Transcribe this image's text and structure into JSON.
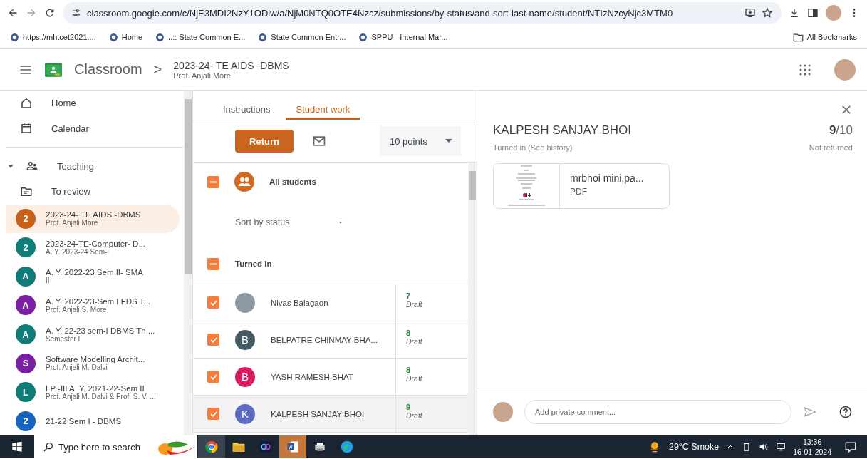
{
  "browser": {
    "url": "classroom.google.com/c/NjE3MDI2NzY1ODlw/a/NjM0NTQ0OTE4Nzcz/submissions/by-status/and-sort-last-name/student/NTIzNzcyNjc3MTM0",
    "bookmarks": [
      {
        "label": "https://mhtcet2021...."
      },
      {
        "label": "Home"
      },
      {
        "label": "..:: State Common E..."
      },
      {
        "label": "State Common Entr..."
      },
      {
        "label": "SPPU - Internal Mar..."
      }
    ],
    "all_bookmarks": "All Bookmarks"
  },
  "header": {
    "app": "Classroom",
    "separator": ">",
    "class_title": "2023-24- TE AIDS -DBMS",
    "teacher": "Prof. Anjali More"
  },
  "sidebar": {
    "nav": [
      {
        "label": "Home"
      },
      {
        "label": "Calendar"
      }
    ],
    "teaching": {
      "label": "Teaching",
      "expanded": true
    },
    "to_review": "To review",
    "classes": [
      {
        "initial": "2",
        "title": "2023-24- TE AIDS -DBMS",
        "subtitle": "Prof. Anjali More",
        "color": "#c5611a",
        "selected": true
      },
      {
        "initial": "2",
        "title": "2023-24-TE-Computer- D...",
        "subtitle": "A. Y. 2023-24 Sem-I",
        "color": "#0f7c78",
        "selected": false
      },
      {
        "initial": "A",
        "title": "A. Y. 2022-23 Sem II- SMA",
        "subtitle": "II",
        "color": "#0f7c78",
        "selected": false
      },
      {
        "initial": "A",
        "title": "A. Y. 2022-23-Sem I FDS T...",
        "subtitle": "Prof. Anjali S. More",
        "color": "#7b1fa2",
        "selected": false
      },
      {
        "initial": "A",
        "title": "A. Y. 22-23 sem-I DBMS Th ...",
        "subtitle": "Semester I",
        "color": "#0f7c78",
        "selected": false
      },
      {
        "initial": "S",
        "title": "Software Modelling Archit...",
        "subtitle": "Prof. Anjali M. Dalvi",
        "color": "#7b1fa2",
        "selected": false
      },
      {
        "initial": "L",
        "title": "LP -III A. Y. 2021-22-Sem II",
        "subtitle": "Prof. Anjali M. Dalvi & Prof. S. V. ...",
        "color": "#0f7c78",
        "selected": false
      },
      {
        "initial": "2",
        "title": "21-22 Sem I - DBMS",
        "color": "#1565c0",
        "selected": false
      }
    ]
  },
  "tabs": [
    {
      "label": "Instructions",
      "selected": false
    },
    {
      "label": "Student work",
      "selected": true
    }
  ],
  "toolbar": {
    "return_button": "Return",
    "points": "10 points"
  },
  "list": {
    "all_students": {
      "label": "All students",
      "indeterminate": true
    },
    "sort": "Sort by status",
    "group": {
      "label": "Turned in",
      "indeterminate": true
    },
    "students": [
      {
        "name": "Nivas Balagaon",
        "kind": "photo",
        "grade": "7",
        "status": "Draft",
        "checked": true,
        "selected": false
      },
      {
        "name": "BELPATRE CHINMAY BHA...",
        "kind": "letter",
        "initial": "B",
        "color": "#455a64",
        "grade": "8",
        "status": "Draft",
        "checked": true,
        "selected": false
      },
      {
        "name": "YASH RAMESH BHAT",
        "kind": "letter",
        "initial": "B",
        "color": "#d81b60",
        "grade": "8",
        "status": "Draft",
        "checked": true,
        "selected": false
      },
      {
        "name": "KALPESH SANJAY BHOI",
        "kind": "letter",
        "initial": "K",
        "color": "#5c6bc0",
        "grade": "9",
        "status": "Draft",
        "checked": true,
        "selected": true
      }
    ]
  },
  "detail": {
    "student": "KALPESH SANJAY BHOI",
    "status": "Turned in (See history)",
    "grade": "9",
    "out_of": "/10",
    "return_state": "Not returned",
    "attachment": {
      "name": "mrbhoi mini.pa...",
      "type": "PDF"
    },
    "comment_placeholder": "Add private comment..."
  },
  "taskbar": {
    "search_placeholder": "Type here to search",
    "weather": "29°C Smoke",
    "time": "13:36",
    "date": "16-01-2024"
  }
}
